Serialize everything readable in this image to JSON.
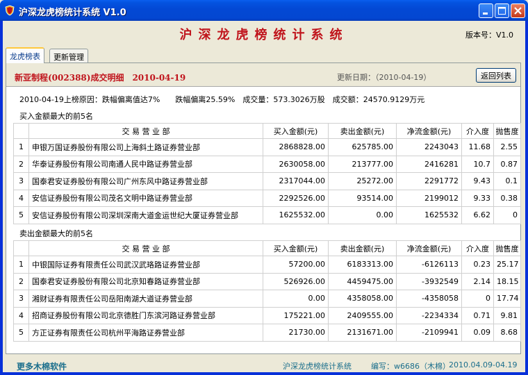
{
  "window": {
    "title": "沪深龙虎榜统计系统 V1.0"
  },
  "header": {
    "title": "沪深龙虎榜统计系统",
    "version": "版本号：V1.0"
  },
  "tabs": [
    {
      "label": "龙虎榜表",
      "active": true
    },
    {
      "label": "更新管理",
      "active": false
    }
  ],
  "detail": {
    "title": "新亚制程(002388)成交明细　2010-04-19",
    "update_date": "更新日期：（2010-04-19）",
    "back_button": "返回列表",
    "reason": "2010-04-19上榜原因：跌幅偏离值达7%　　跌幅偏离25.59%　成交量：573.3026万股　成交额：24570.9129万元"
  },
  "table_headers": [
    "",
    "交 易 营 业 部",
    "买入金额(元)",
    "卖出金额(元)",
    "净流金额(元)",
    "介入度",
    "抛售度"
  ],
  "buy_section": {
    "label": "买入金额最大的前5名",
    "rows": [
      [
        "1",
        "申银万国证券股份有限公司上海斜土路证券营业部",
        "2868828.00",
        "625785.00",
        "2243043",
        "11.68",
        "2.55"
      ],
      [
        "2",
        "华泰证券股份有限公司南通人民中路证券营业部",
        "2630058.00",
        "213777.00",
        "2416281",
        "10.7",
        "0.87"
      ],
      [
        "3",
        "国泰君安证券股份有限公司广州东风中路证券营业部",
        "2317044.00",
        "25272.00",
        "2291772",
        "9.43",
        "0.1"
      ],
      [
        "4",
        "安信证券股份有限公司茂名文明中路证券营业部",
        "2292526.00",
        "93514.00",
        "2199012",
        "9.33",
        "0.38"
      ],
      [
        "5",
        "安信证券股份有限公司深圳深南大道金运世纪大厦证券营业部",
        "1625532.00",
        "0.00",
        "1625532",
        "6.62",
        "0"
      ]
    ]
  },
  "sell_section": {
    "label": "卖出金额最大的前5名",
    "rows": [
      [
        "1",
        "中银国际证券有限责任公司武汉武珞路证券营业部",
        "57200.00",
        "6183313.00",
        "-6126113",
        "0.23",
        "25.17"
      ],
      [
        "2",
        "国泰君安证券股份有限公司北京知春路证券营业部",
        "526926.00",
        "4459475.00",
        "-3932549",
        "2.14",
        "18.15"
      ],
      [
        "3",
        "湘财证券有限责任公司岳阳南湖大道证券营业部",
        "0.00",
        "4358058.00",
        "-4358058",
        "0",
        "17.74"
      ],
      [
        "4",
        "招商证券股份有限公司北京德胜门东滨河路证券营业部",
        "175221.00",
        "2409555.00",
        "-2234334",
        "0.71",
        "9.81"
      ],
      [
        "5",
        "方正证券有限责任公司杭州平海路证券营业部",
        "21730.00",
        "2131671.00",
        "-2109941",
        "0.09",
        "8.68"
      ]
    ]
  },
  "footer": {
    "more_link": "更多木棉软件",
    "app_name": "沪深龙虎榜统计系统",
    "author": "编写：w6686（木棉）",
    "date_range": "2010.04.09-04.19"
  },
  "colors": {
    "title_red": "#C0141C",
    "titlebar_blue": "#0348D4",
    "footer_teal": "#1A6E8C"
  }
}
